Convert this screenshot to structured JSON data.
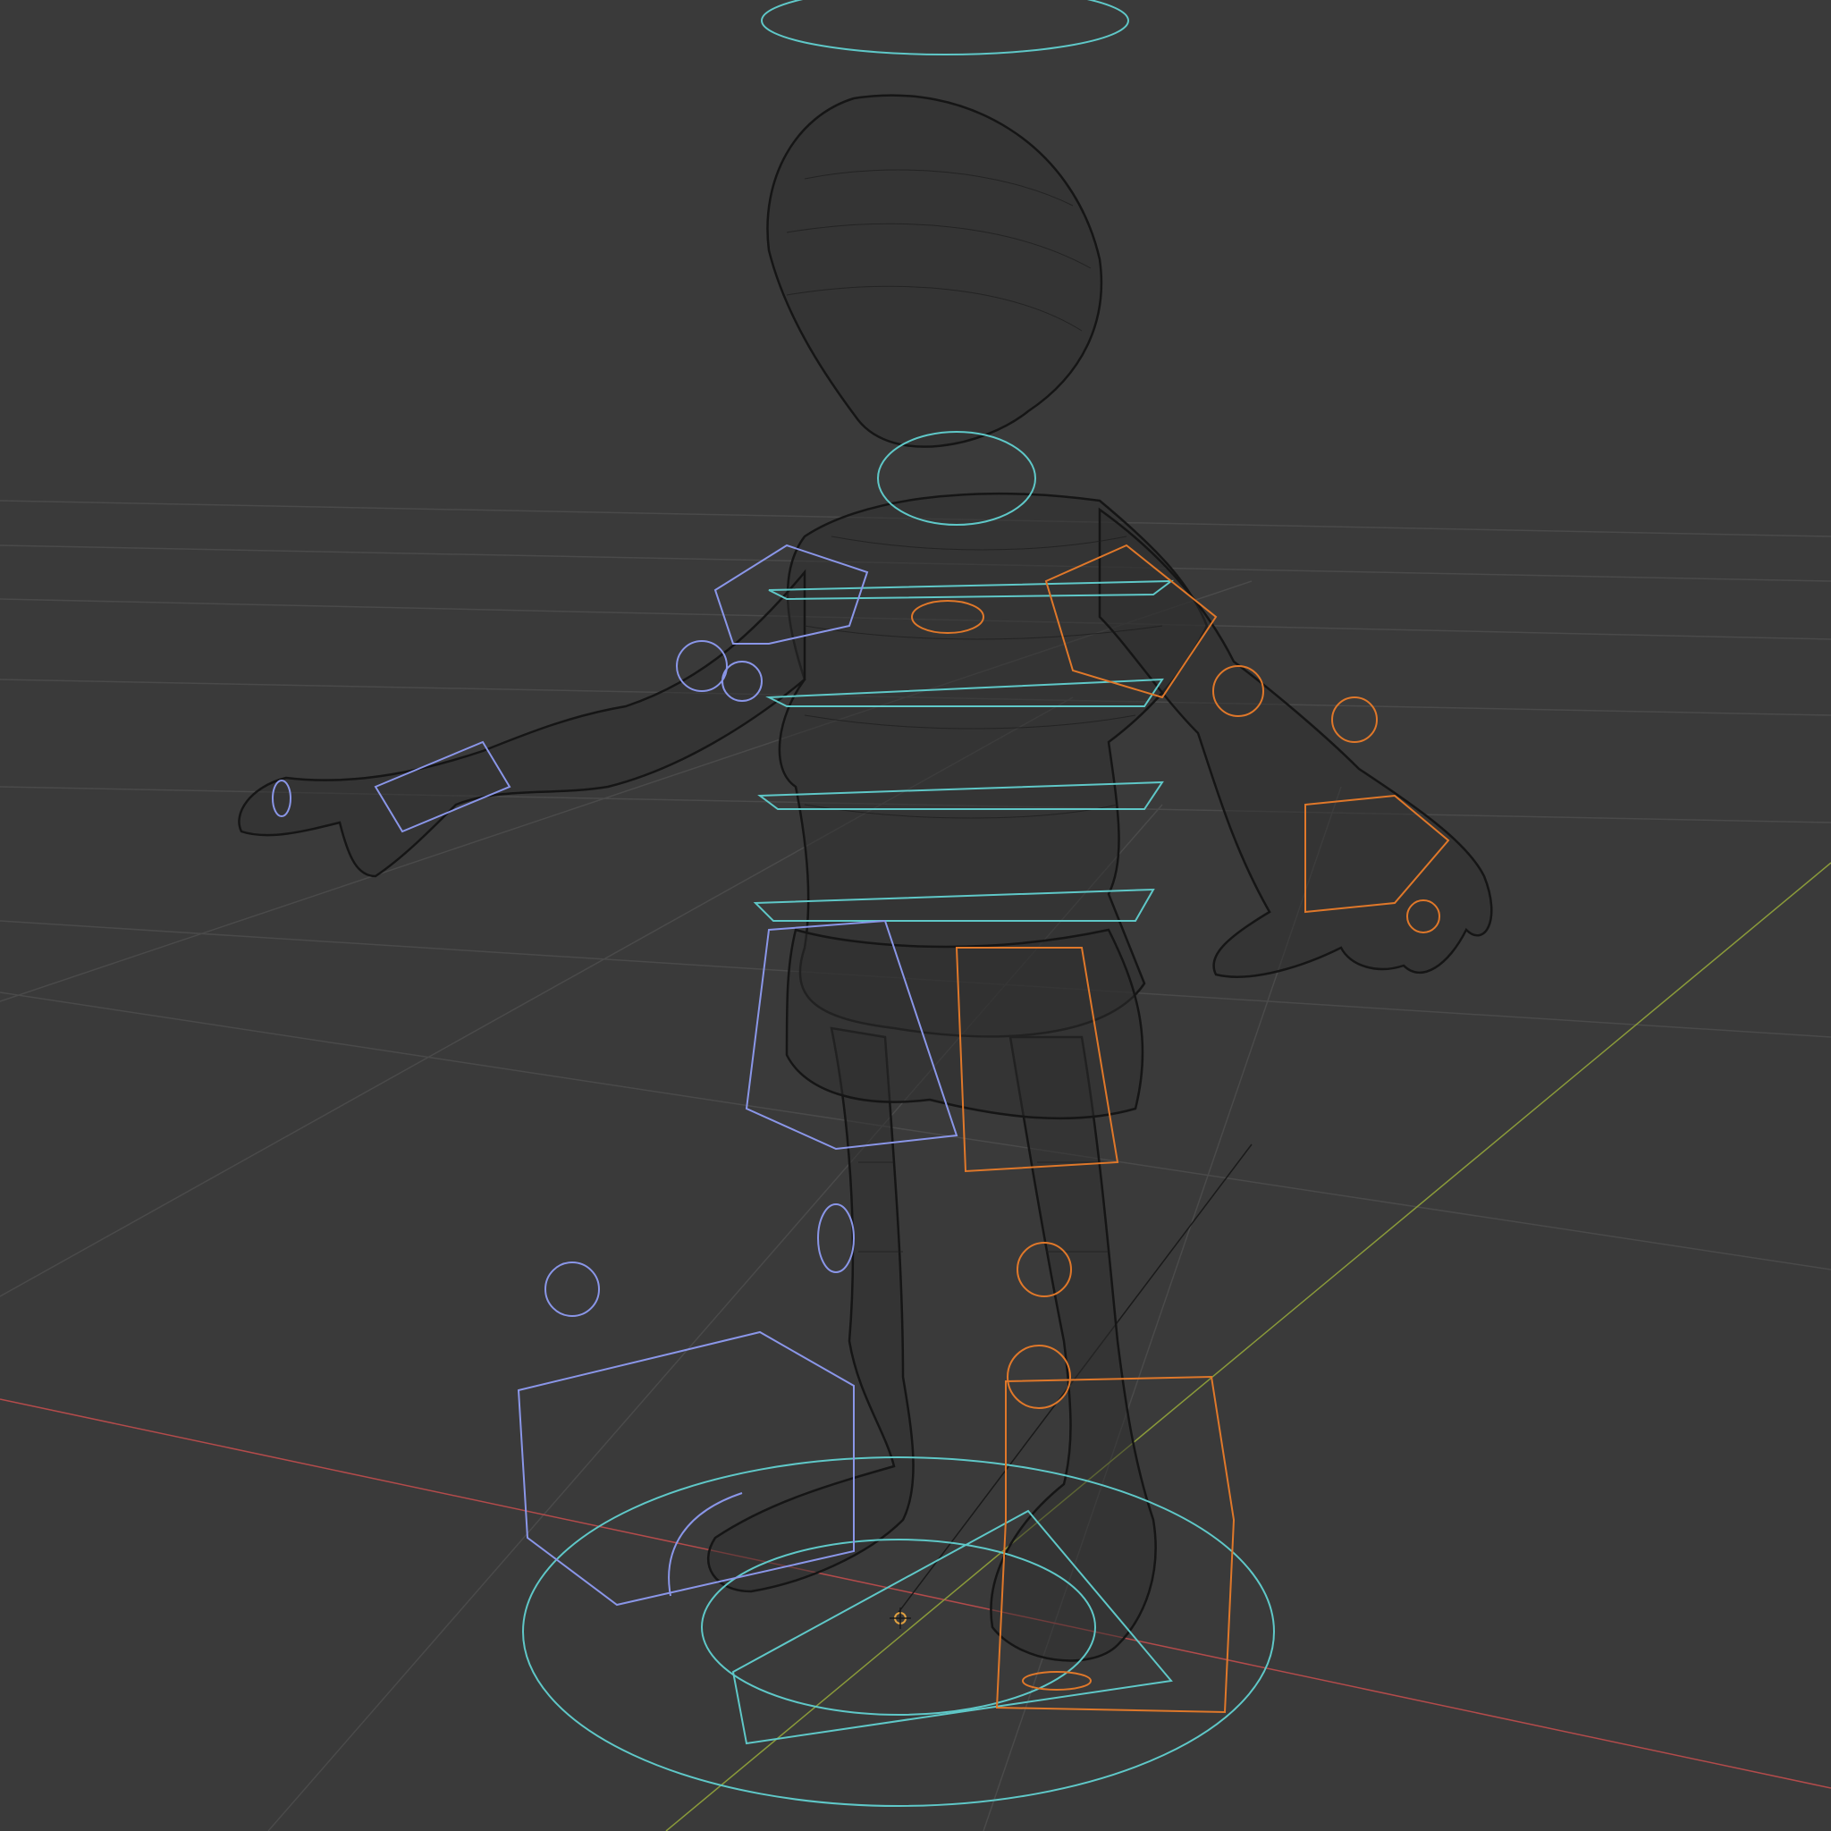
{
  "viewport": {
    "background": "#3a3a3a",
    "grid_color": "#4a4a4a",
    "x_axis_color": "#b34b4b",
    "y_axis_color": "#8a9a3a"
  },
  "rig": {
    "center_color": "#5fc8c8",
    "left_color": "#8a96e8",
    "right_color": "#e0782a",
    "mesh_color": "#151515"
  },
  "origin_icon": "origin-icon",
  "objects": [
    "character-mesh",
    "armature"
  ]
}
